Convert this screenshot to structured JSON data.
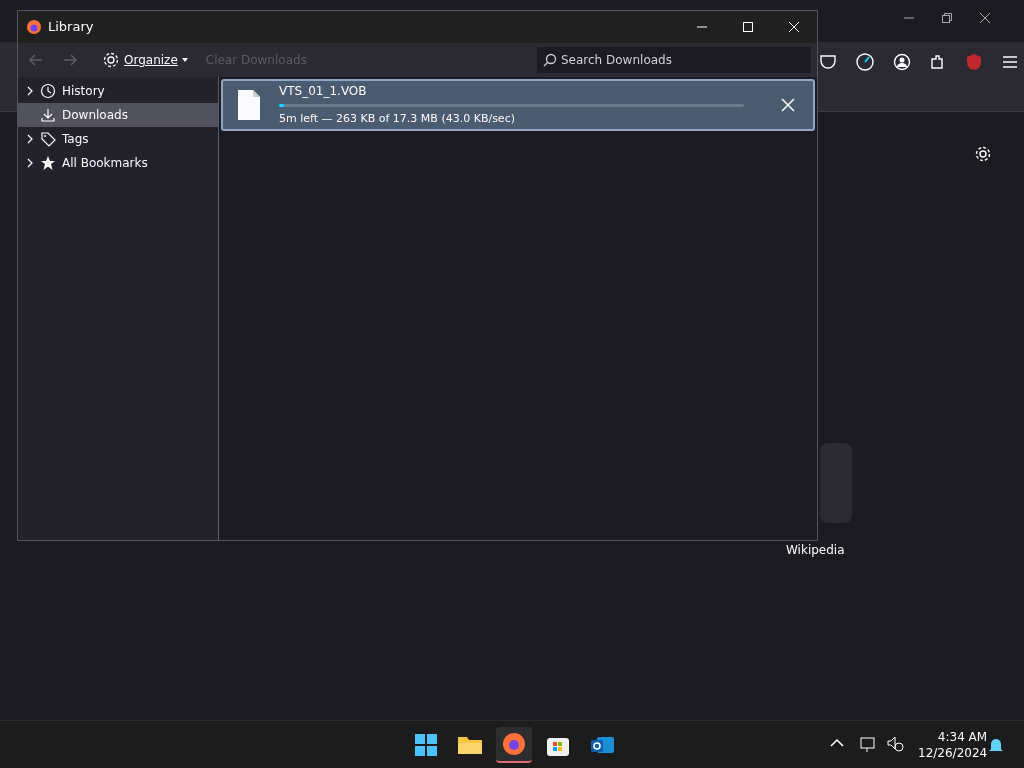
{
  "window": {
    "title": "Library"
  },
  "toolbar": {
    "back": {
      "disabled": true
    },
    "forward": {
      "disabled": true
    },
    "organize": "Organize",
    "clear": {
      "label": "Clear Downloads",
      "disabled": true
    },
    "search": {
      "placeholder": "Search Downloads"
    }
  },
  "sidebar": {
    "items": [
      {
        "kind": "history",
        "label": "History",
        "expandable": true,
        "selected": false
      },
      {
        "kind": "downloads",
        "label": "Downloads",
        "expandable": false,
        "selected": true
      },
      {
        "kind": "tags",
        "label": "Tags",
        "expandable": true,
        "selected": false
      },
      {
        "kind": "bookmarks",
        "label": "All Bookmarks",
        "expandable": true,
        "selected": false
      }
    ]
  },
  "downloads": [
    {
      "name": "VTS_01_1.VOB",
      "status": "5m left — 263 KB of 17.3 MB (43.0 KB/sec)",
      "level": 0.01,
      "selected": true
    }
  ],
  "background": {
    "shortcut_label": "Wikipedia"
  },
  "taskbar": {
    "time": "4:34 AM",
    "date": "12/26/2024"
  }
}
